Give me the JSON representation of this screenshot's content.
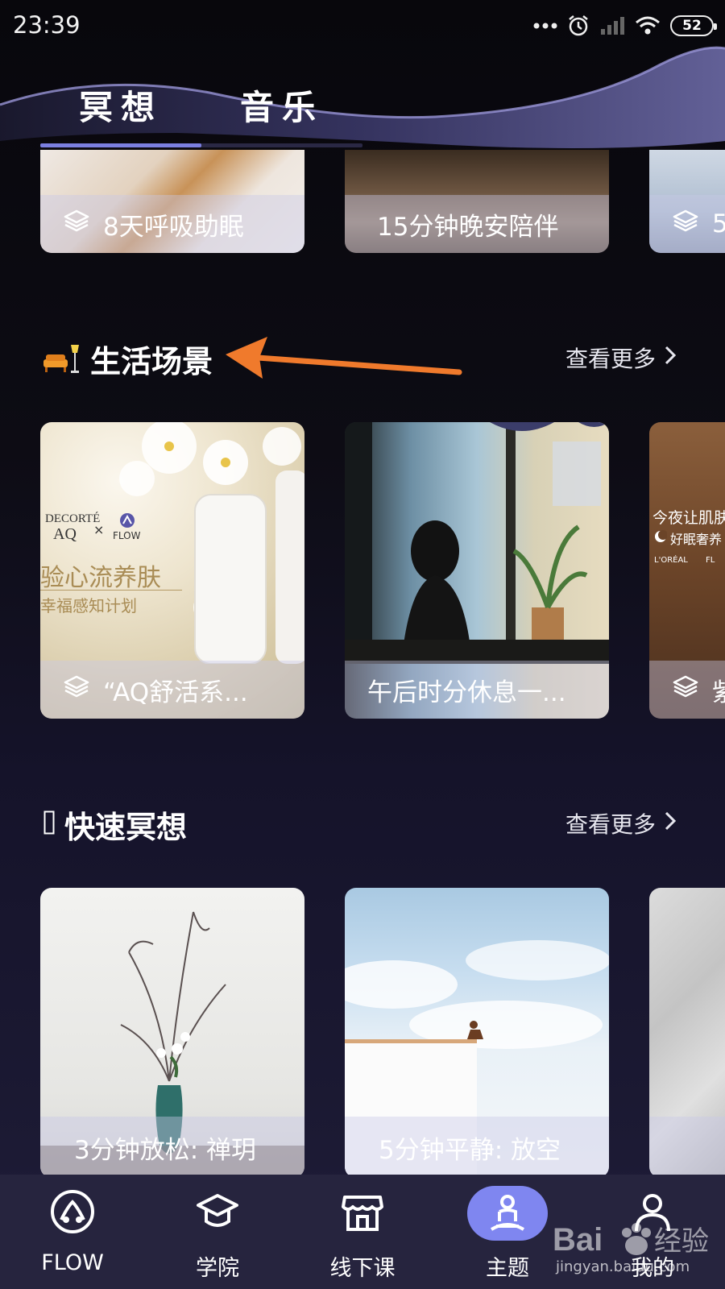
{
  "status_bar": {
    "time": "23:39",
    "battery": "52"
  },
  "top_tabs": [
    {
      "label": "冥想"
    },
    {
      "label": "音乐"
    }
  ],
  "row1_cards": [
    {
      "label": "8天呼吸助眠"
    },
    {
      "label": "15分钟晚安陪伴"
    },
    {
      "label": "5"
    }
  ],
  "life_section": {
    "title": "生活场景",
    "more": "查看更多"
  },
  "life_cards": [
    {
      "label": "“AQ舒活系...",
      "brand_decorte": "DECORTÉ",
      "brand_aq": "AQ",
      "brand_x": "×",
      "brand_flow": "FLOW",
      "headline": "验心流养肤",
      "subline": "幸福感知计划"
    },
    {
      "label": "午后时分休息一..."
    },
    {
      "label": "紫",
      "headline": "今夜让肌肤",
      "subline": "好眠奢养",
      "brand_loreal": "L'ORÉAL",
      "brand_fl": "FL"
    }
  ],
  "quick_section": {
    "title": "快速冥想",
    "more": "查看更多"
  },
  "quick_cards": [
    {
      "label": "3分钟放松: 禅玥"
    },
    {
      "label": "5分钟平静: 放空"
    }
  ],
  "bottom_nav": [
    {
      "label": "FLOW",
      "icon": "flow-logo-icon"
    },
    {
      "label": "学院",
      "icon": "graduation-cap-icon"
    },
    {
      "label": "线下课",
      "icon": "storefront-icon"
    },
    {
      "label": "主题",
      "icon": "meditation-person-icon",
      "active": true
    },
    {
      "label": "我的",
      "icon": "person-icon"
    }
  ],
  "watermark": {
    "text": "jingyan.baidu.com"
  },
  "colors": {
    "accent": "#7f86f0",
    "arrow_annotation": "#f07a2c",
    "nav_background": "#26243e"
  }
}
